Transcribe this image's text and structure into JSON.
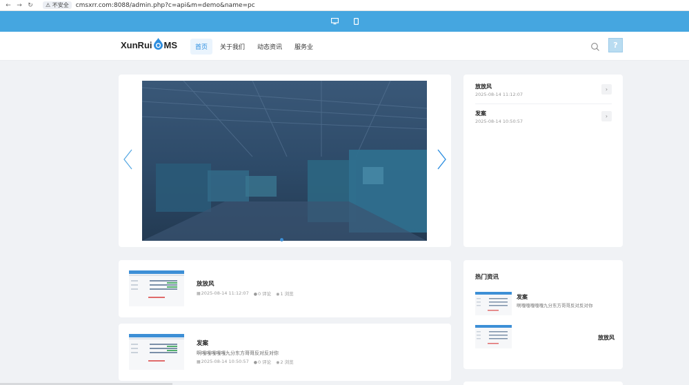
{
  "browser": {
    "back_icon": "arrow-left-icon",
    "warning_label": "⚠ 不安全",
    "url": "cmsxrr.com:8088/admin.php?c=api&m=demo&name=pc"
  },
  "device_bar": {
    "color": "#45a6e0",
    "items": [
      {
        "icon": "desktop-icon"
      },
      {
        "icon": "mobile-icon"
      }
    ]
  },
  "header": {
    "logo_left": "XunRui",
    "logo_right": "MS",
    "nav": [
      {
        "label": "首页",
        "active": true
      },
      {
        "label": "关于我们"
      },
      {
        "label": "动态资讯"
      },
      {
        "label": "服务业"
      }
    ],
    "help_label": "?"
  },
  "slider": {
    "accent": "#3d8fd6"
  },
  "side_list": [
    {
      "title": "放放风",
      "date": "2025-08-14 11:12:07",
      "arrow": "›"
    },
    {
      "title": "发案",
      "date": "2025-08-14 10:50:57",
      "arrow": "›"
    }
  ],
  "posts": [
    {
      "title": "放放风",
      "desc": "",
      "date": "2025-08-14 11:12:07",
      "comments": "0 评论",
      "views": "1 浏览"
    },
    {
      "title": "发案",
      "desc": "啊嘎嘎嘎嘎嘎九分东方哥哥反对反对你",
      "date": "2025-08-14 10:50:57",
      "comments": "0 评论",
      "views": "2 浏览"
    }
  ],
  "hot": {
    "title": "热门资讯",
    "items": [
      {
        "title": "发案",
        "desc": "啊嘎嘎嘎嘎嘎九分东方哥哥反对反对你"
      },
      {
        "title": "放放风",
        "desc": ""
      }
    ]
  }
}
